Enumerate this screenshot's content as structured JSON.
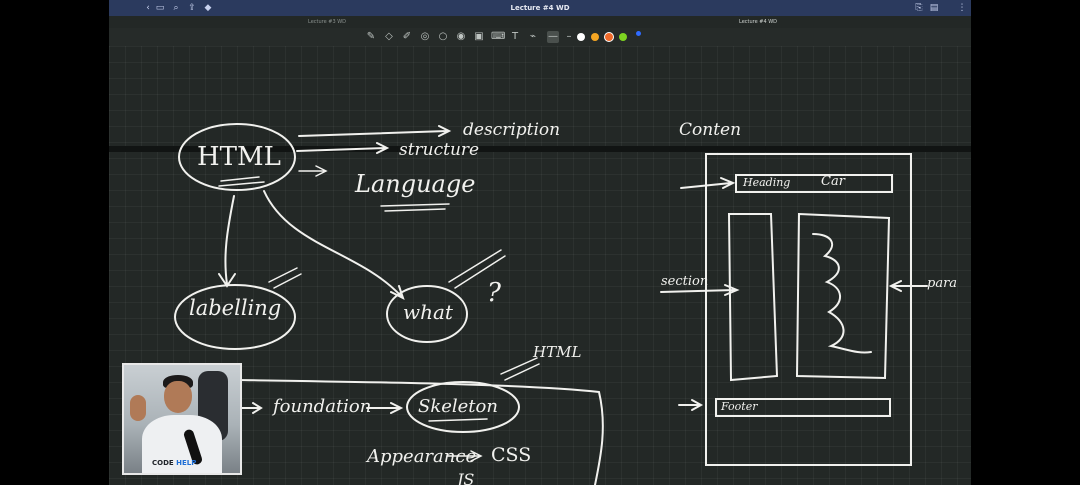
{
  "window": {
    "title": "Lecture #4 WD",
    "titlebar_icons": [
      "back-icon",
      "sidebar-icon",
      "search-icon",
      "share-icon",
      "bookmark-icon",
      "outline-icon",
      "document-icon",
      "more-icon"
    ]
  },
  "tabs": [
    {
      "label": "Lecture #3 WD",
      "active": false
    },
    {
      "label": "Lecture #4 WD",
      "active": true
    }
  ],
  "toolbar": {
    "tools": [
      "pen-icon",
      "eraser-icon",
      "highlighter-icon",
      "shapes-icon",
      "lasso-icon",
      "camera-icon",
      "image-icon",
      "keyboard-icon",
      "text-icon",
      "laser-icon"
    ],
    "pen_colors": [
      "#ffffff",
      "#f5a623",
      "#f06a2a",
      "#7ed321",
      "#2f6bff"
    ]
  },
  "notes": {
    "top_left": {
      "html": "HTML",
      "description": "description",
      "structure": "structure",
      "language": "Language",
      "labelling": "labelling",
      "what": "what",
      "question": "?"
    },
    "bottom_left": {
      "html_small": "HTML",
      "foundation": "foundation",
      "skeleton": "Skeleton",
      "appearance": "Appearance",
      "css": "CSS",
      "js": "JS"
    },
    "right": {
      "content": "Conten",
      "heading": "Heading",
      "car": "Car",
      "section": "section",
      "para": "para",
      "footer": "Footer"
    }
  },
  "webcam": {
    "logo_text": "CODE",
    "logo_accent": "HELP"
  }
}
